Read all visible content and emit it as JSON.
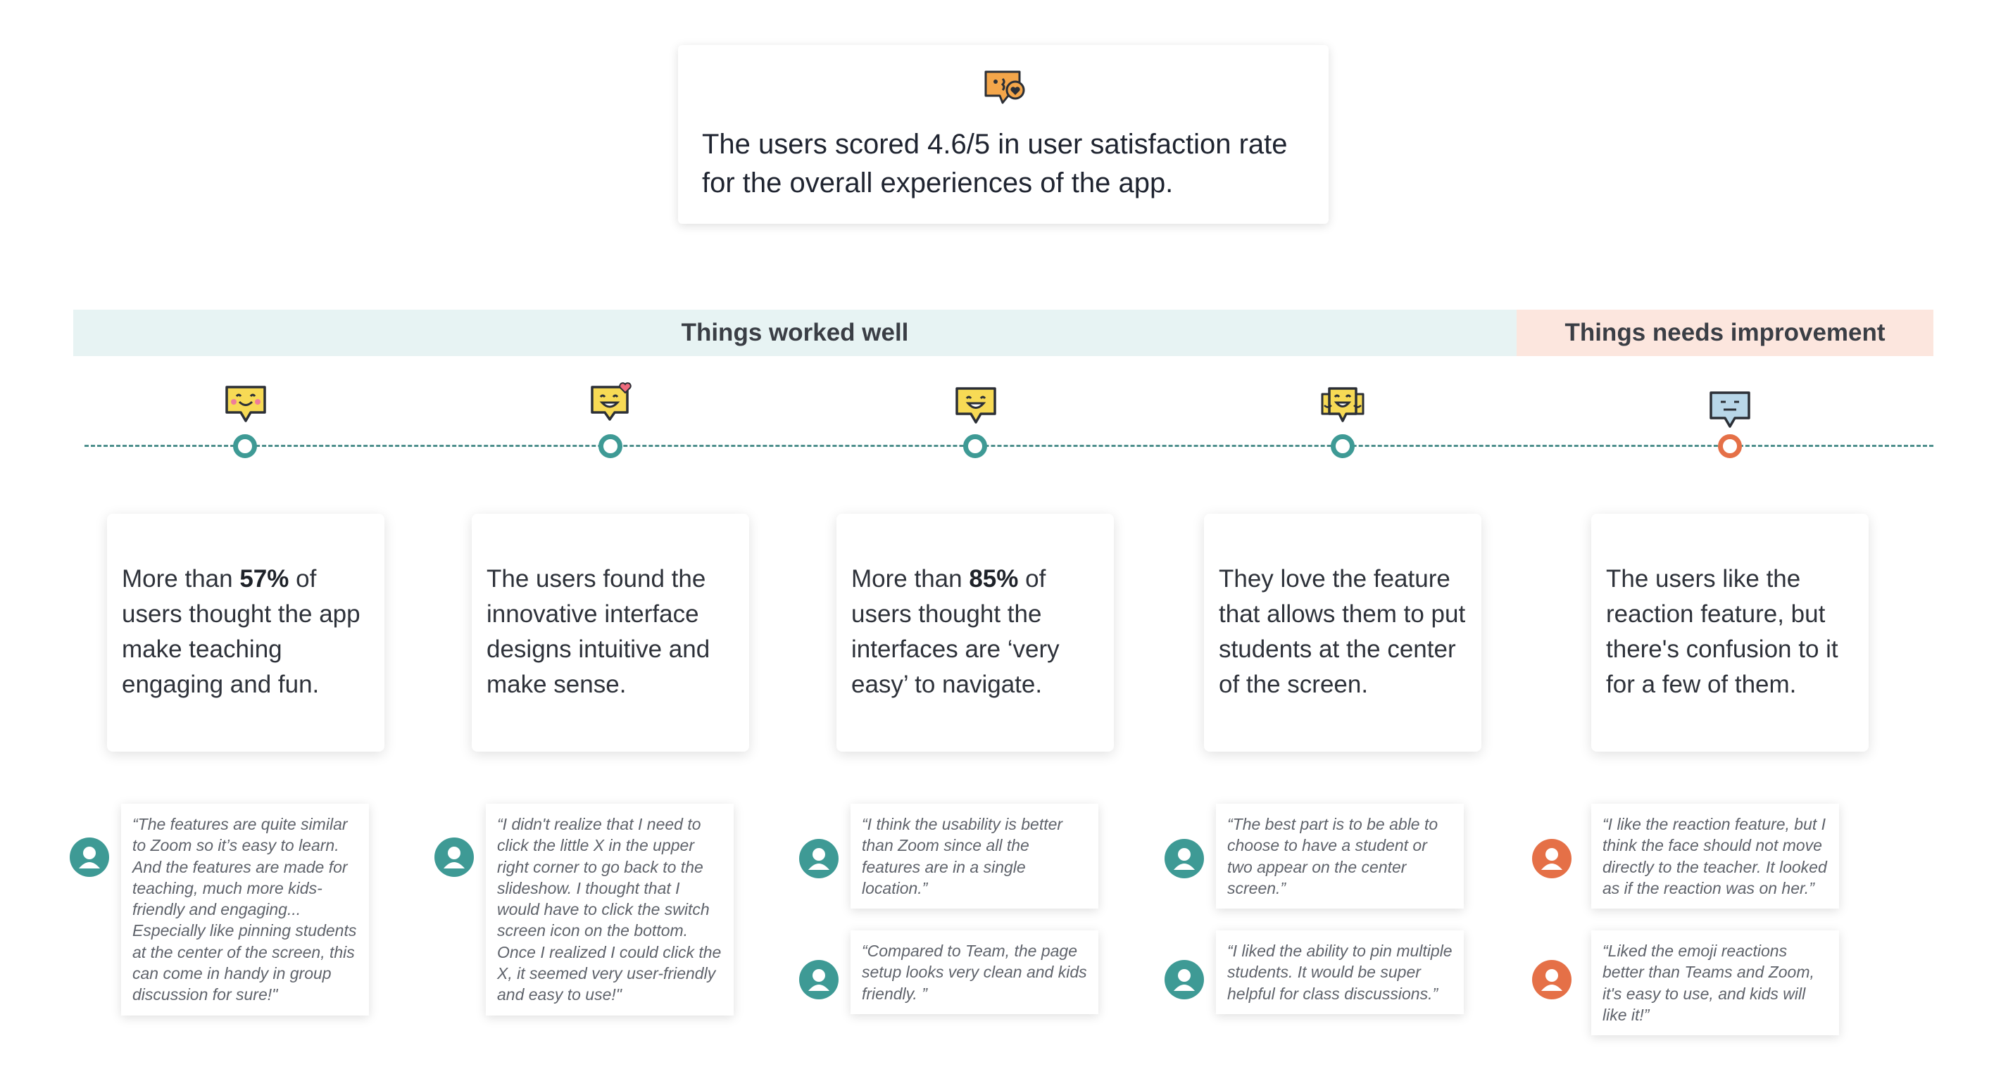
{
  "summary": {
    "icon": "speech-bubble-heart-icon",
    "text_line1": "The users scored 4.6/5 in user satisfaction rate",
    "text_line2": "for the overall experiences of the app."
  },
  "bands": {
    "worked_well": "Things worked well",
    "needs_improvement": "Things needs improvement"
  },
  "colors": {
    "teal": "#3e9a95",
    "orange": "#e57047",
    "good_band": "#e7f3f3",
    "bad_band": "#fce6de",
    "emoji_yellow": "#f7da55",
    "emoji_blue": "#b8d6e8",
    "emoji_orange": "#f4a64a"
  },
  "findings": [
    {
      "icon": "happy-blush-bubble-icon",
      "pre": "More than ",
      "bold": "57%",
      "post": " of users thought the app make teaching engaging and fun."
    },
    {
      "icon": "happy-heart-bubble-icon",
      "pre": "The users found the innovative interface designs intuitive and make sense.",
      "bold": "",
      "post": ""
    },
    {
      "icon": "grin-bubble-icon",
      "pre": "More than ",
      "bold": "85%",
      "post": " of users thought the interfaces are ‘very easy’ to navigate."
    },
    {
      "icon": "group-bubble-icon",
      "pre": "They love the feature that allows them to put students at the center of the screen.",
      "bold": "",
      "post": ""
    },
    {
      "icon": "neutral-bubble-icon",
      "pre": "The users like the reaction feature, but there's confusion to it for a few of them.",
      "bold": "",
      "post": ""
    }
  ],
  "quotes": {
    "q1": "“The features are quite similar to Zoom so it’s easy to learn. And the features are made for teaching, much more kids-friendly and engaging... Especially like pinning students at the center of the screen, this can come in handy in group discussion for sure!\"",
    "q2": "“I didn't realize that I need to click the little X in the upper right corner to go back to the slideshow. I thought that I would have to click the switch screen icon on the bottom. Once I realized I could click the X, it seemed very user-friendly and easy to use!\"",
    "q3a": "“I think the usability is better than Zoom since all the features are in a single location.”",
    "q3b": "“Compared to Team, the page setup looks very clean and kids friendly. ”",
    "q4a": "“The best part is to be able to choose to have a student or two appear on the center screen.”",
    "q4b": "“I liked the ability to pin multiple students. It would be super helpful for class discussions.”",
    "q5a": "“I like the reaction feature, but I think the face should not move directly to the teacher. It looked as if the reaction was on her.”",
    "q5b": "“Liked the emoji reactions better than Teams and Zoom, it's easy to use, and kids will like it!”"
  }
}
